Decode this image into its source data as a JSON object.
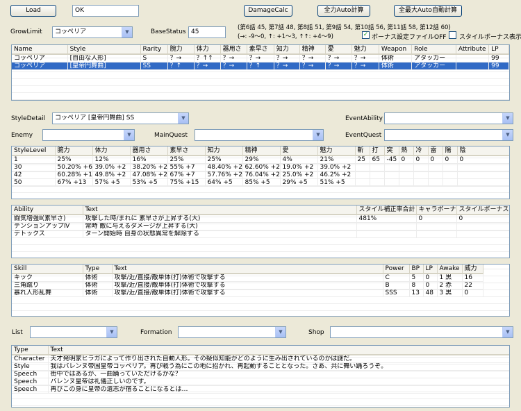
{
  "toolbar": {
    "load_label": "Load",
    "status_value": "OK",
    "damage_calc_label": "DamageCalc",
    "full_auto_label": "全力Auto計算",
    "max_auto_label": "全最大Auto自動計算"
  },
  "filters": {
    "grow_limit_label": "GrowLimit",
    "grow_limit_value": "コッペリア",
    "base_status_label": "BaseStatus",
    "base_status_value": "45",
    "episode_info": "(第6話 45, 第7話 48, 第8話 51, 第9話 54, 第10話 56, 第11話 58, 第12話 60)",
    "arrow_legend": "(→: -9〜0, ↑: +1〜3, ↑↑: +4〜9)",
    "bonus_file_off_label": "ボーナス設定ファイルOFF",
    "bonus_file_off_checked": true,
    "style_bonus_label": "スタイルボーナス表示",
    "style_bonus_checked": false
  },
  "style_list": {
    "columns": [
      "Name",
      "Style",
      "Rarity",
      "腕力",
      "体力",
      "器用さ",
      "素早さ",
      "知力",
      "精神",
      "愛",
      "魅力",
      "Weapon",
      "Role",
      "Attribute",
      "LP"
    ],
    "rows": [
      [
        "コッペリア",
        "[自由な人形]",
        "S",
        "？→",
        "？↑↑",
        "？→",
        "？→",
        "？→",
        "？→",
        "？→",
        "？→",
        "体術",
        "アタッカー",
        "",
        "99"
      ],
      [
        "コッペリア",
        "[皇帝円舞曲]",
        "SS",
        "？↑",
        "？→",
        "？→",
        "？↑",
        "？→",
        "？→",
        "？→",
        "？→",
        "体術",
        "アタッカー",
        "",
        "99"
      ]
    ],
    "selected_index": 1
  },
  "detail": {
    "style_detail_label": "StyleDetail",
    "style_detail_value": "コッペリア [皇帝円舞曲] SS",
    "event_ability_label": "EventAbility",
    "event_ability_value": "",
    "enemy_label": "Enemy",
    "enemy_value": "",
    "main_quest_label": "MainQuest",
    "main_quest_value": "",
    "event_quest_label": "EventQuest",
    "event_quest_value": ""
  },
  "level_table": {
    "columns": [
      "StyleLevel",
      "腕力",
      "体力",
      "器用さ",
      "素早さ",
      "知力",
      "精神",
      "愛",
      "魅力",
      "斬",
      "打",
      "突",
      "熱",
      "冷",
      "雷",
      "陽",
      "陰"
    ],
    "rows": [
      [
        "1",
        "25%",
        "12%",
        "16%",
        "25%",
        "25%",
        "29%",
        "4%",
        "21%",
        "25",
        "65",
        "-45",
        "0",
        "0",
        "0",
        "0",
        "0"
      ],
      [
        "30",
        "50.20% +6",
        "39.0% +2",
        "38.20% +2",
        "55% +7",
        "48.40% +2",
        "62.60% +2",
        "19.0% +2",
        "39.0% +2",
        "",
        "",
        "",
        "",
        "",
        "",
        "",
        ""
      ],
      [
        "42",
        "60.28% +10",
        "49.8% +2",
        "47.08% +2",
        "67% +7",
        "57.76% +2",
        "76.04% +2",
        "25.0% +2",
        "46.2% +2",
        "",
        "",
        "",
        "",
        "",
        "",
        "",
        ""
      ],
      [
        "50",
        "67% +13",
        "57% +5",
        "53% +5",
        "75% +15",
        "64% +5",
        "85% +5",
        "29% +5",
        "51% +5",
        "",
        "",
        "",
        "",
        "",
        "",
        "",
        ""
      ]
    ]
  },
  "ability_table": {
    "columns": [
      "Ability",
      "Text",
      "スタイル補正率合計",
      "キャラボーナス",
      "スタイルボーナス"
    ],
    "rows": [
      [
        "闘気増強Ⅱ(素早さ)",
        "攻撃した時/まれに 素早さが上昇する(大)",
        "481%",
        "0",
        "0"
      ],
      [
        "テンションアップⅣ",
        "常時 敵に与えるダメージが上昇する(大)",
        "",
        "",
        ""
      ],
      [
        "デトックス",
        "ターン開始時 自身の状態異常を解除する",
        "",
        "",
        ""
      ]
    ]
  },
  "skill_table": {
    "columns": [
      "Skill",
      "Type",
      "Text",
      "Power",
      "BP",
      "LP",
      "Awake",
      "威力"
    ],
    "rows": [
      [
        "キック",
        "体術",
        "攻撃/近/直接/敵単体(打)体術で攻撃する",
        "C",
        "5",
        "0",
        "1 黒",
        "16"
      ],
      [
        "三角蹴り",
        "体術",
        "攻撃/近/直接/敵単体(打)体術で攻撃する",
        "B",
        "8",
        "0",
        "2 赤",
        "22"
      ],
      [
        "暴れ人形乱舞",
        "体術",
        "攻撃/近/直接/敵単体(打)体術で攻撃する",
        "SSS",
        "13",
        "48",
        "3 黒",
        "0"
      ]
    ]
  },
  "bottom": {
    "list_label": "List",
    "list_value": "",
    "formation_label": "Formation",
    "formation_value": "",
    "shop_label": "Shop",
    "shop_value": ""
  },
  "text_table": {
    "columns": [
      "Type",
      "Text"
    ],
    "rows": [
      [
        "Character",
        "天才発明家ヒラガによって作り出された自動人形。その疑似知能がどのように生み出されているのかは謎だ。"
      ],
      [
        "Style",
        "我はバレンヌ帝国皇帝コッペリア。再び戦う為にこの地に招かれ、再起動することとなった。さあ、共に舞い踊ろうぞ。"
      ],
      [
        "Speech",
        "街中ではあるが、一曲踊っていただけるかな？"
      ],
      [
        "Speech",
        "バレンヌ皇帝は礼儀正しいのです。"
      ],
      [
        "Speech",
        "再びこの身に皇帝の遺志が宿ることになるとは…"
      ]
    ]
  }
}
